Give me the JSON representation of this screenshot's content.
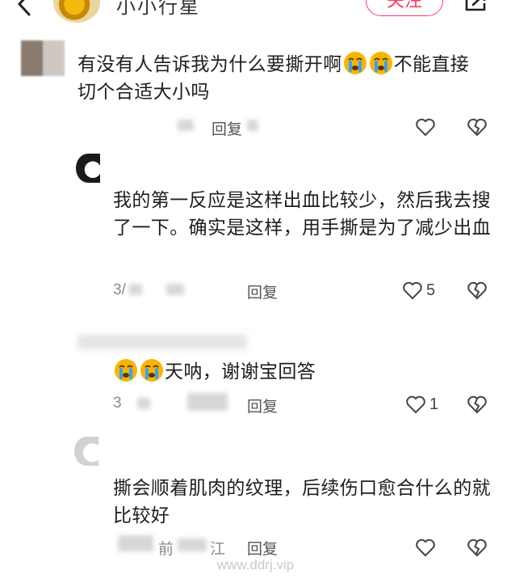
{
  "header": {
    "author_name": "小小行星",
    "follow_label": "关注"
  },
  "comments": [
    {
      "text_a": "有没有人告诉我为什么要撕开啊",
      "text_b": "不能直接",
      "text_c": "切个合适大小吗",
      "reply_label": "回复"
    },
    {
      "text": "我的第一反应是这样出血比较少，然后我去搜了一下。确实是这样，用手撕是为了减少出血",
      "meta_partial": "3/",
      "reply_label": "回复",
      "like_count": "5"
    },
    {
      "text": "天呐，谢谢宝回答",
      "meta_partial": "3",
      "reply_label": "回复",
      "like_count": "1"
    },
    {
      "text": "撕会顺着肌肉的纹理，后续伤口愈合什么的就比较好",
      "meta_partial_a": "前",
      "meta_partial_b": "江",
      "reply_label": "回复"
    }
  ],
  "watermark": "www.ddrj.vip",
  "colors": {
    "accent": "#ff3b5c",
    "emoji_face": "#f7b500",
    "tear": "#3aa0ff"
  },
  "icons": [
    "back-arrow-icon",
    "share-icon",
    "heart-icon",
    "broken-heart-icon",
    "crying-face-emoji"
  ]
}
